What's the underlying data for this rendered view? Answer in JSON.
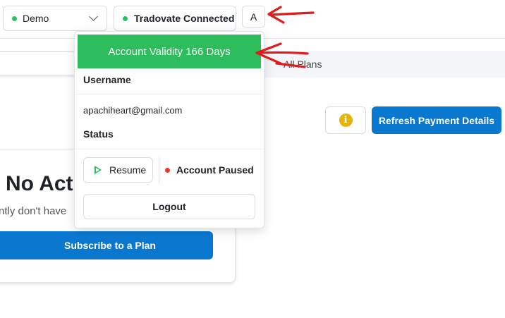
{
  "header": {
    "environment": {
      "value": "Demo",
      "status_color": "#22c55e"
    },
    "connection": {
      "label": "Tradovate Connected",
      "status_color": "#22c55e"
    },
    "avatar_initial": "A"
  },
  "tabs": {
    "all_plans": "All Plans"
  },
  "actions": {
    "info_icon": "i",
    "refresh_label": "Refresh Payment Details"
  },
  "card": {
    "title": "No Act",
    "subtitle": "ntly don't have",
    "subscribe_label": "Subscribe to a Plan"
  },
  "account_menu": {
    "validity": "Account Validity 166 Days",
    "username_label": "Username",
    "email": "apachiheart@gmail.com",
    "status_label": "Status",
    "resume_label": "Resume",
    "status_value": "Account Paused",
    "logout_label": "Logout"
  },
  "colors": {
    "accent_blue": "#0b78d0",
    "success_green": "#2dbd5c",
    "paused_red": "#e53935",
    "annotation_red": "#e01b1b"
  }
}
